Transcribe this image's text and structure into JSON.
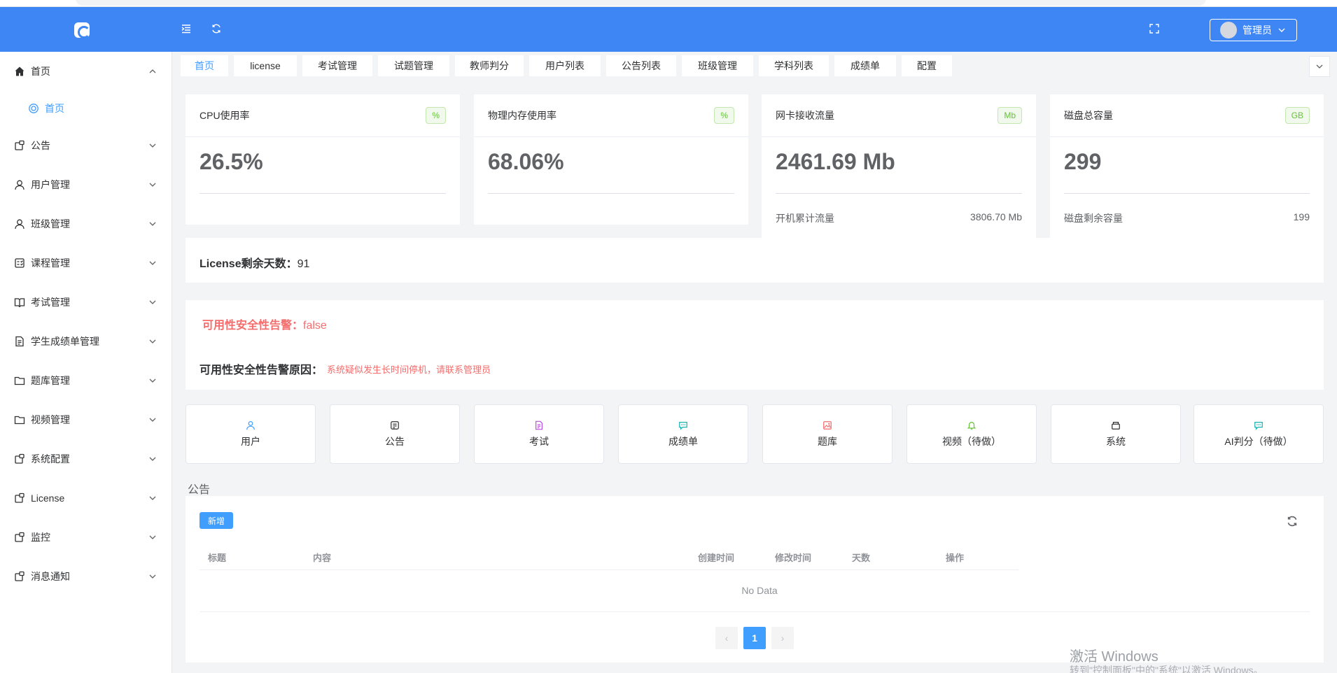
{
  "header": {
    "user_label": "管理员"
  },
  "sidebar": {
    "items": [
      {
        "label": "首页",
        "icon": "home-icon",
        "expanded": true,
        "sub": [
          "首页"
        ]
      },
      {
        "label": "公告",
        "icon": "doc-icon"
      },
      {
        "label": "用户管理",
        "icon": "user-icon"
      },
      {
        "label": "班级管理",
        "icon": "user-icon"
      },
      {
        "label": "课程管理",
        "icon": "course-icon"
      },
      {
        "label": "考试管理",
        "icon": "book-icon"
      },
      {
        "label": "学生成绩单管理",
        "icon": "document-icon"
      },
      {
        "label": "题库管理",
        "icon": "folder-icon"
      },
      {
        "label": "视频管理",
        "icon": "folder-icon"
      },
      {
        "label": "系统配置",
        "icon": "doc-icon"
      },
      {
        "label": "License",
        "icon": "doc-icon"
      },
      {
        "label": "监控",
        "icon": "doc-icon"
      },
      {
        "label": "消息通知",
        "icon": "doc-icon"
      }
    ]
  },
  "tabs": [
    "首页",
    "license",
    "考试管理",
    "试题管理",
    "教师判分",
    "用户列表",
    "公告列表",
    "班级管理",
    "学科列表",
    "成绩单",
    "配置"
  ],
  "stats": [
    {
      "title": "CPU使用率",
      "tag": "%",
      "value": "26.5%"
    },
    {
      "title": "物理内存使用率",
      "tag": "%",
      "value": "68.06%"
    },
    {
      "title": "网卡接收流量",
      "tag": "Mb",
      "value": "2461.69 Mb",
      "foot_label": "开机累计流量",
      "foot_value": "3806.70 Mb"
    },
    {
      "title": "磁盘总容量",
      "tag": "GB",
      "value": "299",
      "foot_label": "磁盘剩余容量",
      "foot_value": "199"
    }
  ],
  "license": {
    "label": "License剩余天数：",
    "value": "91"
  },
  "alert": {
    "label": "可用性安全性告警：",
    "value": "false"
  },
  "alert_reason": {
    "label": "可用性安全性告警原因：",
    "value": "系统疑似发生长时间停机，请联系管理员"
  },
  "shortcuts": [
    {
      "label": "用户",
      "icon": "user-icon",
      "color": "#409eff"
    },
    {
      "label": "公告",
      "icon": "notice-icon",
      "color": "#303133"
    },
    {
      "label": "考试",
      "icon": "exam-icon",
      "color": "#c04ee0"
    },
    {
      "label": "成绩单",
      "icon": "chat-icon",
      "color": "#1ab1b1"
    },
    {
      "label": "题库",
      "icon": "picture-icon",
      "color": "#f56c6c"
    },
    {
      "label": "视频（待做）",
      "icon": "bell-icon",
      "color": "#67c23a"
    },
    {
      "label": "系统",
      "icon": "box-icon",
      "color": "#303133"
    },
    {
      "label": "AI判分（待做）",
      "icon": "chat-icon",
      "color": "#1ab1b1"
    }
  ],
  "notice": {
    "section_title": "公告",
    "add_label": "新增",
    "columns": [
      "标题",
      "内容",
      "创建时间",
      "修改时间",
      "天数",
      "操作"
    ],
    "empty_text": "No Data",
    "pager": {
      "prev": "‹",
      "current": "1",
      "next": "›"
    }
  },
  "watermark": {
    "title": "激活 Windows",
    "subtitle": "转到\"控制面板\"中的\"系统\"以激活 Windows。"
  }
}
